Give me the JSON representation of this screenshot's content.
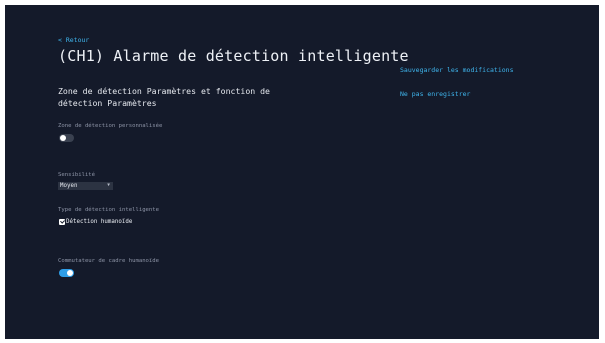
{
  "header": {
    "back_label": "< Retour",
    "title": "(CH1) Alarme de détection intelligente"
  },
  "section": {
    "title": "Zone de détection Paramètres et fonction de détection Paramètres"
  },
  "custom_zone": {
    "label": "Zone de détection personnalisée",
    "enabled": false
  },
  "sensitivity": {
    "label": "Sensibilité",
    "value": "Moyen"
  },
  "detection_type": {
    "label": "Type de détection intelligente",
    "option_label": "Détection humanoïde",
    "checked": true
  },
  "humanoid_frame": {
    "label": "Commutateur de cadre humanoïde",
    "enabled": true
  },
  "actions": {
    "save_label": "Sauvegarder les modifications",
    "discard_label": "Ne pas enregistrer"
  },
  "colors": {
    "background": "#141a2a",
    "accent": "#3fb6ee",
    "toggle_on": "#2e9ee8"
  }
}
